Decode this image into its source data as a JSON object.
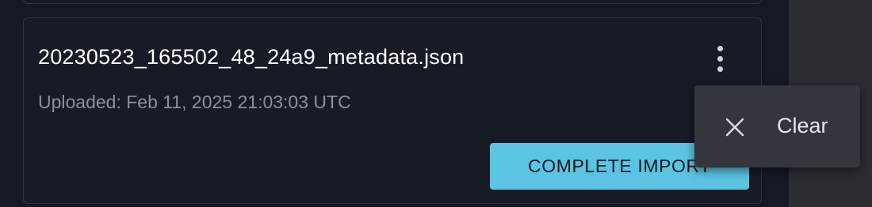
{
  "file_card": {
    "filename": "20230523_165502_48_24a9_metadata.json",
    "uploaded": "Uploaded: Feb 11, 2025 21:03:03 UTC",
    "complete_import_label": "COMPLETE IMPORT",
    "more_icon": "more-vert-icon"
  },
  "context_menu": {
    "items": [
      {
        "label": "Clear",
        "icon": "close-icon"
      }
    ]
  },
  "colors": {
    "background": "#151922",
    "card_background": "#171b24",
    "card_border": "#30343d",
    "accent_button": "#5bc4e2",
    "menu_background": "#33363c",
    "muted_text": "#8b9099"
  }
}
